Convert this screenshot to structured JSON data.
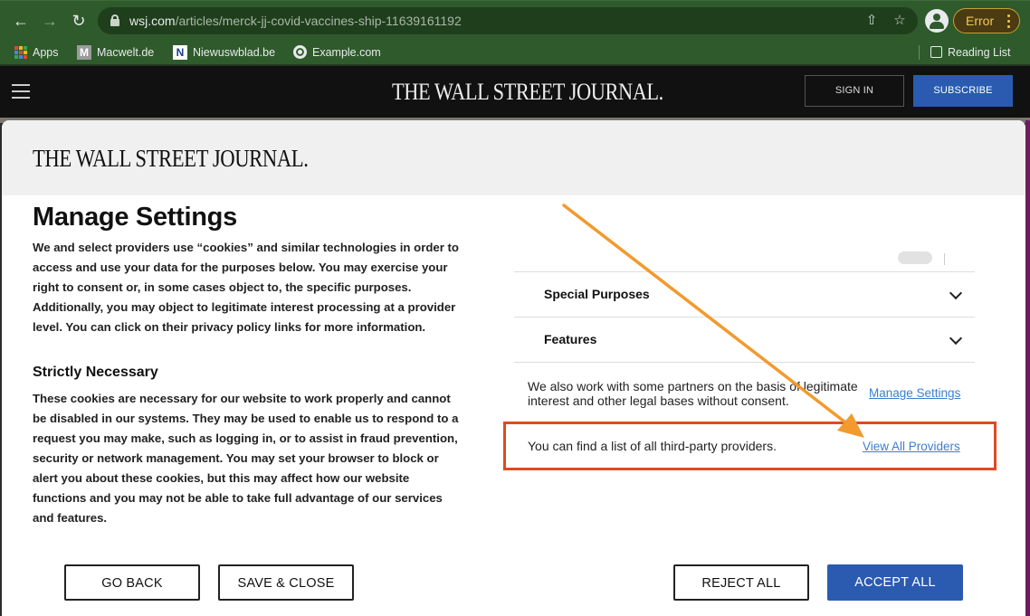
{
  "browser": {
    "url_host": "wsj.com",
    "url_path": "/articles/merck-jj-covid-vaccines-ship-11639161192",
    "error_label": "Error",
    "bookmarks": [
      "Apps",
      "Macwelt.de",
      "Niewuswblad.be",
      "Example.com"
    ],
    "reading_list": "Reading List"
  },
  "header": {
    "masthead": "THE WALL STREET JOURNAL.",
    "sign_in": "SIGN IN",
    "subscribe": "SUBSCRIBE"
  },
  "modal": {
    "logo": "THE WALL STREET JOURNAL.",
    "title": "Manage Settings",
    "intro": "We and select providers use “cookies” and similar technologies in order to access and use your data for the purposes below. You may exercise your right to consent or, in some cases object to, the specific purposes. Additionally, you may object to legitimate interest processing at a provider level. You can click on their privacy policy links for more information.",
    "section_title": "Strictly Necessary",
    "section_body": "These cookies are necessary for our website to work properly and cannot be disabled in our systems. They may be used to enable us to respond to a request you may make, such as logging in, or to assist in fraud prevention, security or network management. You may set your browser to block or alert you about these cookies, but this may affect how our website functions and you may not be able to take full advantage of our services and features.",
    "accordion": [
      "Special Purposes",
      "Features"
    ],
    "partners_text": "We also work with some partners on the basis of legitimate interest and other legal bases without consent.",
    "manage_link": "Manage Settings",
    "providers_text": "You can find a list of all third-party providers.",
    "providers_link": "View All Providers",
    "buttons": {
      "go_back": "GO BACK",
      "save_close": "SAVE & CLOSE",
      "reject_all": "REJECT ALL",
      "accept_all": "ACCEPT ALL"
    }
  },
  "colors": {
    "toolbar": "#2f5a2b",
    "subscribe": "#2a5bb0",
    "highlight_box": "#e04a22",
    "annotation_arrow": "#f29a2e",
    "link": "#3b7ed0"
  }
}
